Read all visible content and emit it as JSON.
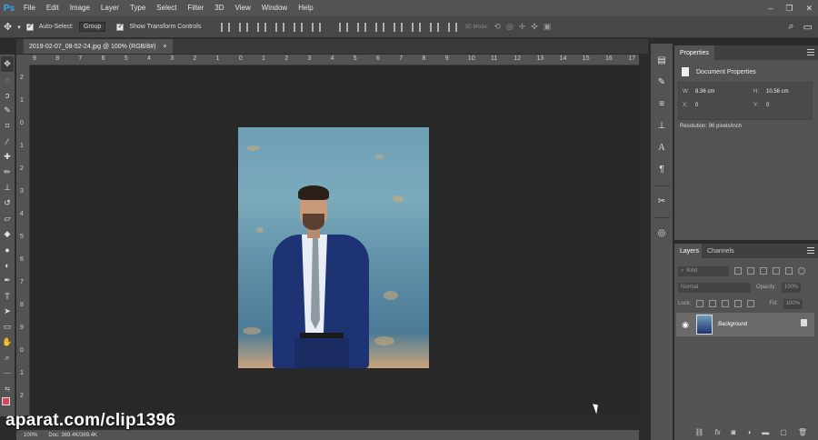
{
  "app": {
    "logo": "Ps"
  },
  "menu": [
    "File",
    "Edit",
    "Image",
    "Layer",
    "Type",
    "Select",
    "Filter",
    "3D",
    "View",
    "Window",
    "Help"
  ],
  "window_controls": [
    "–",
    "❐",
    "✕"
  ],
  "options_bar": {
    "auto_select_label": "Auto-Select:",
    "auto_select_value": "Group",
    "show_transform_label": "Show Transform Controls",
    "mode_3d_label": "3D Mode:"
  },
  "document": {
    "tab_title": "2019-02-07_08-52-24.jpg @ 100% (RGB/8#)",
    "close": "×"
  },
  "ruler": {
    "top_ticks": [
      "9",
      "8",
      "7",
      "6",
      "5",
      "4",
      "3",
      "2",
      "1",
      "0",
      "1",
      "2",
      "3",
      "4",
      "5",
      "6",
      "7",
      "8",
      "9",
      "10",
      "11",
      "12",
      "13",
      "14",
      "15",
      "16",
      "17"
    ],
    "left_ticks": [
      "2",
      "1",
      "0",
      "1",
      "2",
      "3",
      "4",
      "5",
      "6",
      "7",
      "8",
      "9",
      "0",
      "1",
      "2"
    ]
  },
  "status": {
    "zoom": "100%",
    "doc_info": "Doc: 369.4K/369.4K"
  },
  "watermark": "aparat.com/clip1396",
  "properties": {
    "tab": "Properties",
    "title": "Document Properties",
    "w_label": "W:",
    "w_value": "8.36 cm",
    "h_label": "H:",
    "h_value": "10.56 cm",
    "x_label": "X:",
    "x_value": "0",
    "y_label": "Y:",
    "y_value": "0",
    "resolution": "Resolution: 96 pixels/inch"
  },
  "layers": {
    "tab_layers": "Layers",
    "tab_channels": "Channels",
    "filter_label": "Kind",
    "blend_mode": "Normal",
    "opacity_label": "Opacity:",
    "opacity_value": "100%",
    "lock_label": "Lock:",
    "fill_label": "Fill:",
    "fill_value": "100%",
    "items": [
      {
        "name": "Background"
      }
    ]
  }
}
